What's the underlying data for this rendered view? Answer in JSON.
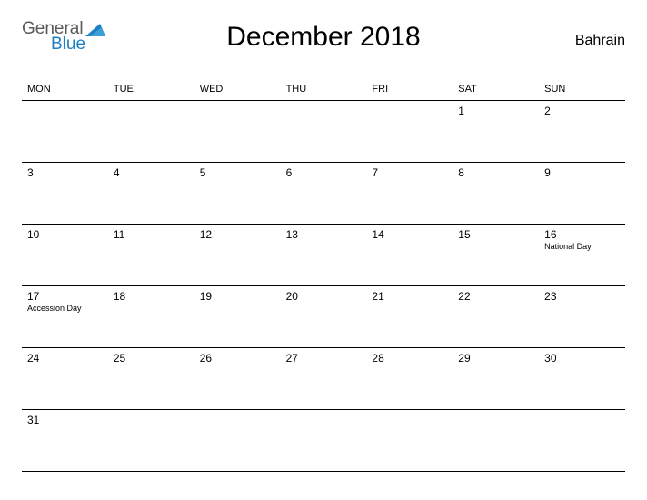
{
  "logo": {
    "word1": "General",
    "word2": "Blue"
  },
  "title": "December 2018",
  "region": "Bahrain",
  "weekdays": [
    "MON",
    "TUE",
    "WED",
    "THU",
    "FRI",
    "SAT",
    "SUN"
  ],
  "weeks": [
    [
      {
        "n": "",
        "e": ""
      },
      {
        "n": "",
        "e": ""
      },
      {
        "n": "",
        "e": ""
      },
      {
        "n": "",
        "e": ""
      },
      {
        "n": "",
        "e": ""
      },
      {
        "n": "1",
        "e": ""
      },
      {
        "n": "2",
        "e": ""
      }
    ],
    [
      {
        "n": "3",
        "e": ""
      },
      {
        "n": "4",
        "e": ""
      },
      {
        "n": "5",
        "e": ""
      },
      {
        "n": "6",
        "e": ""
      },
      {
        "n": "7",
        "e": ""
      },
      {
        "n": "8",
        "e": ""
      },
      {
        "n": "9",
        "e": ""
      }
    ],
    [
      {
        "n": "10",
        "e": ""
      },
      {
        "n": "11",
        "e": ""
      },
      {
        "n": "12",
        "e": ""
      },
      {
        "n": "13",
        "e": ""
      },
      {
        "n": "14",
        "e": ""
      },
      {
        "n": "15",
        "e": ""
      },
      {
        "n": "16",
        "e": "National Day"
      }
    ],
    [
      {
        "n": "17",
        "e": "Accession Day"
      },
      {
        "n": "18",
        "e": ""
      },
      {
        "n": "19",
        "e": ""
      },
      {
        "n": "20",
        "e": ""
      },
      {
        "n": "21",
        "e": ""
      },
      {
        "n": "22",
        "e": ""
      },
      {
        "n": "23",
        "e": ""
      }
    ],
    [
      {
        "n": "24",
        "e": ""
      },
      {
        "n": "25",
        "e": ""
      },
      {
        "n": "26",
        "e": ""
      },
      {
        "n": "27",
        "e": ""
      },
      {
        "n": "28",
        "e": ""
      },
      {
        "n": "29",
        "e": ""
      },
      {
        "n": "30",
        "e": ""
      }
    ],
    [
      {
        "n": "31",
        "e": ""
      },
      {
        "n": "",
        "e": ""
      },
      {
        "n": "",
        "e": ""
      },
      {
        "n": "",
        "e": ""
      },
      {
        "n": "",
        "e": ""
      },
      {
        "n": "",
        "e": ""
      },
      {
        "n": "",
        "e": ""
      }
    ]
  ]
}
